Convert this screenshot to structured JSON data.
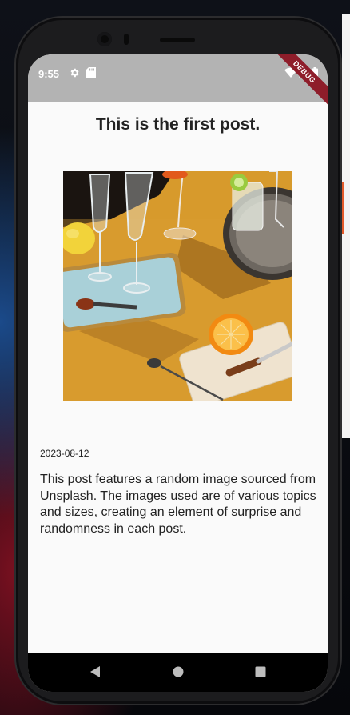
{
  "status_bar": {
    "time": "9:55",
    "debug_banner": "DEBUG",
    "icons": [
      "gear-icon",
      "sd-card-icon",
      "wifi-icon",
      "signal-icon",
      "battery-icon"
    ]
  },
  "post": {
    "title": "This is the first post.",
    "image_alt": "cocktail-table-photo",
    "date": "2023-08-12",
    "body": "This post features a random image sourced from Unsplash. The images used are of various topics and sizes, creating an element of surprise and randomness in each post."
  },
  "nav_bar": {
    "icons": [
      "back-icon",
      "home-icon",
      "recents-icon"
    ]
  },
  "colors": {
    "status_bar_bg": "#b3b3b3",
    "screen_bg": "#fafafa",
    "text": "#222222",
    "debug_ribbon": "#8e1d2a"
  }
}
